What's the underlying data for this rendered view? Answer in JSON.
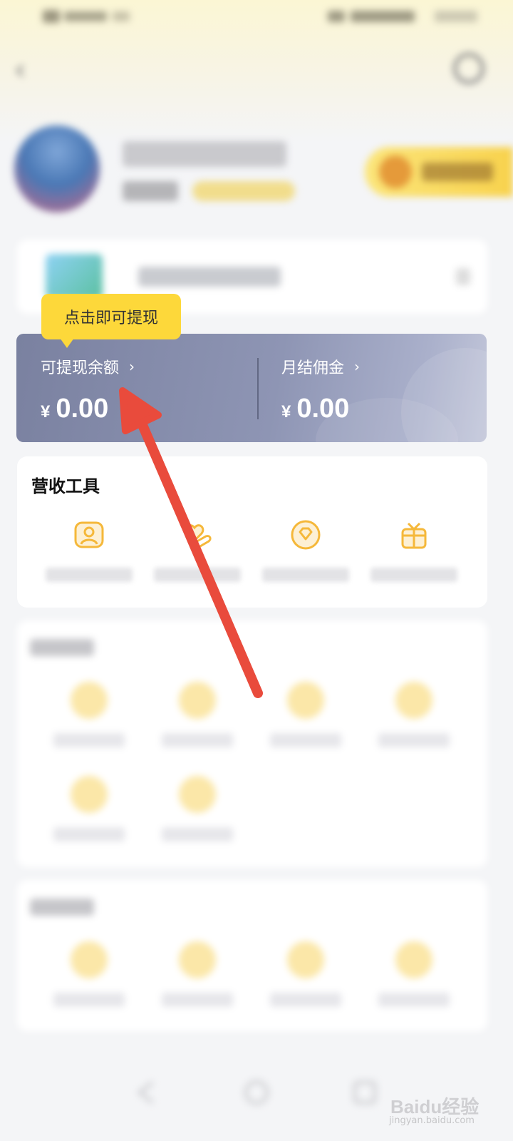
{
  "status_bar": {
    "left": "",
    "right": ""
  },
  "nav": {
    "back_icon": "chevron-left-icon",
    "title": "",
    "help_icon": "headset-icon"
  },
  "profile": {
    "username": "",
    "badge": "",
    "gold_label": ""
  },
  "notice": {
    "text": ""
  },
  "tooltip": {
    "text": "点击即可提现"
  },
  "balance": {
    "withdrawable": {
      "label": "可提现余额",
      "currency": "¥",
      "amount": "0.00",
      "chevron": "›"
    },
    "monthly": {
      "label": "月结佣金",
      "currency": "¥",
      "amount": "0.00",
      "chevron": "›"
    }
  },
  "revenue_tools": {
    "title": "营收工具",
    "items": [
      {
        "icon": "user-frame-icon",
        "label": ""
      },
      {
        "icon": "heart-hand-icon",
        "label": ""
      },
      {
        "icon": "diamond-icon",
        "label": ""
      },
      {
        "icon": "gift-icon",
        "label": ""
      }
    ]
  },
  "section2": {
    "title": "",
    "items": [
      "",
      "",
      "",
      "",
      "",
      ""
    ]
  },
  "section3": {
    "title": "",
    "items": [
      "",
      "",
      "",
      ""
    ]
  },
  "bottom_nav": {
    "items": [
      "back-icon",
      "home-icon",
      "recent-apps-icon"
    ]
  },
  "watermark": {
    "text": "Baidu经验",
    "sub": "jingyan.baidu.com"
  },
  "colors": {
    "tooltip": "#fdd83a",
    "balance_card": "#8e95b4",
    "annotation_arrow": "#e94b3c",
    "icon_accent": "#f5b83a"
  }
}
